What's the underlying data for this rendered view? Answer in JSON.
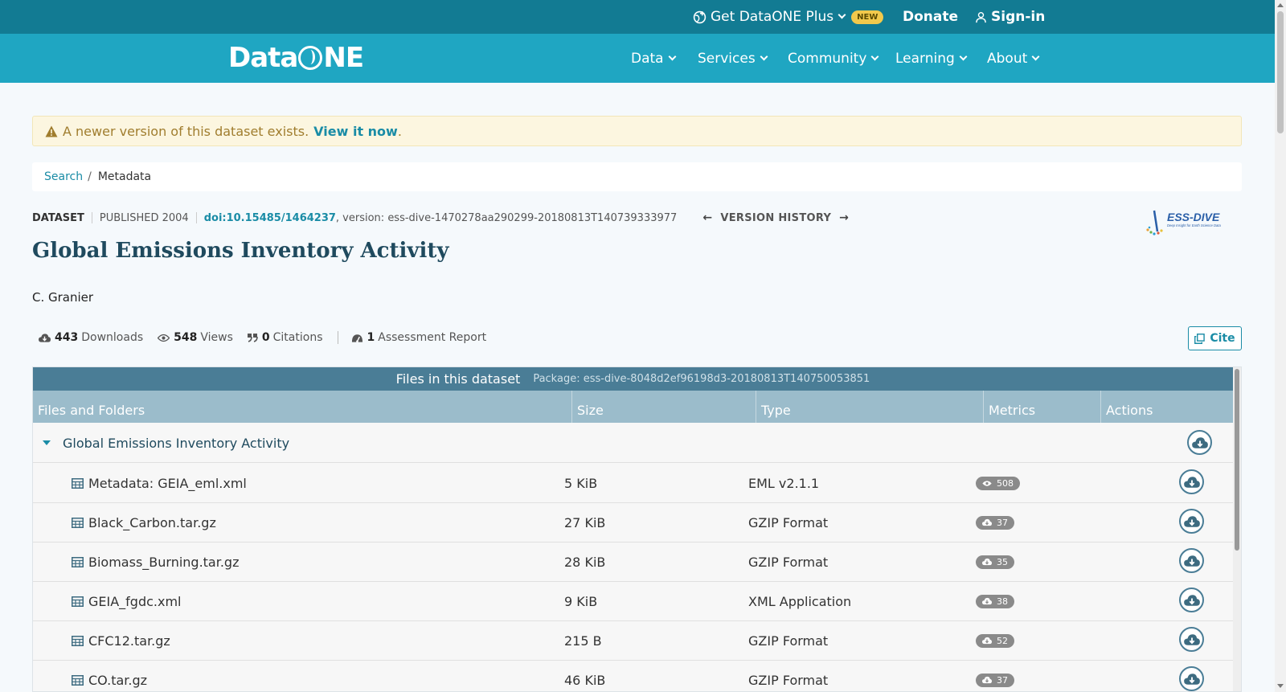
{
  "topbar": {
    "plus_label": "Get DataONE Plus",
    "plus_badge": "NEW",
    "donate_label": "Donate",
    "signin_label": "Sign-in"
  },
  "nav": {
    "logo_text_left": "Data",
    "logo_text_right": "NE",
    "items": [
      {
        "label": "Data"
      },
      {
        "label": "Services"
      },
      {
        "label": "Community"
      },
      {
        "label": "Learning"
      },
      {
        "label": "About"
      }
    ]
  },
  "alert": {
    "text": "A newer version of this dataset exists.",
    "link": "View it now",
    "trailing": "."
  },
  "breadcrumb": {
    "search": "Search",
    "sep": "/",
    "current": "Metadata"
  },
  "meta": {
    "type": "DATASET",
    "published": "PUBLISHED 2004",
    "doi": "doi:10.15485/1464237",
    "version": ", version: ess-dive-1470278aa290299-20180813T140739333977",
    "version_history": "VERSION HISTORY"
  },
  "repository_logo": {
    "name": "ESS-DIVE",
    "tagline": "Deep Insight for Earth Science Data"
  },
  "title": "Global Emissions Inventory Activity",
  "author": "C. Granier",
  "metrics": {
    "downloads_count": "443",
    "downloads_label": "Downloads",
    "views_count": "548",
    "views_label": "Views",
    "citations_count": "0",
    "citations_label": "Citations",
    "assessment_count": "1",
    "assessment_label": "Assessment Report"
  },
  "cite_label": "Cite",
  "files": {
    "heading": "Files in this dataset",
    "package": "Package: ess-dive-8048d2ef96198d3-20180813T140750053851",
    "columns": [
      "Files and Folders",
      "Size",
      "Type",
      "Metrics",
      "Actions"
    ],
    "folder": "Global Emissions Inventory Activity",
    "rows": [
      {
        "name": "Metadata: GEIA_eml.xml",
        "size": "5 KiB",
        "type": "EML v2.1.1",
        "metric": "508",
        "metric_icon": "eye-icon"
      },
      {
        "name": "Black_Carbon.tar.gz",
        "size": "27 KiB",
        "type": "GZIP Format",
        "metric": "37",
        "metric_icon": "cloud-download-icon"
      },
      {
        "name": "Biomass_Burning.tar.gz",
        "size": "28 KiB",
        "type": "GZIP Format",
        "metric": "35",
        "metric_icon": "cloud-download-icon"
      },
      {
        "name": "GEIA_fgdc.xml",
        "size": "9 KiB",
        "type": "XML Application",
        "metric": "38",
        "metric_icon": "cloud-download-icon"
      },
      {
        "name": "CFC12.tar.gz",
        "size": "215 B",
        "type": "GZIP Format",
        "metric": "52",
        "metric_icon": "cloud-download-icon"
      },
      {
        "name": "CO.tar.gz",
        "size": "46 KiB",
        "type": "GZIP Format",
        "metric": "37",
        "metric_icon": "cloud-download-icon"
      }
    ]
  },
  "colors": {
    "topbar": "#127b93",
    "navbar": "#1fa6c2",
    "link": "#1a8ca6",
    "title": "#1f4a5e",
    "table_header": "#4a7d96",
    "table_subheader": "#9bbccb",
    "alert_bg": "#fcf6e0"
  }
}
